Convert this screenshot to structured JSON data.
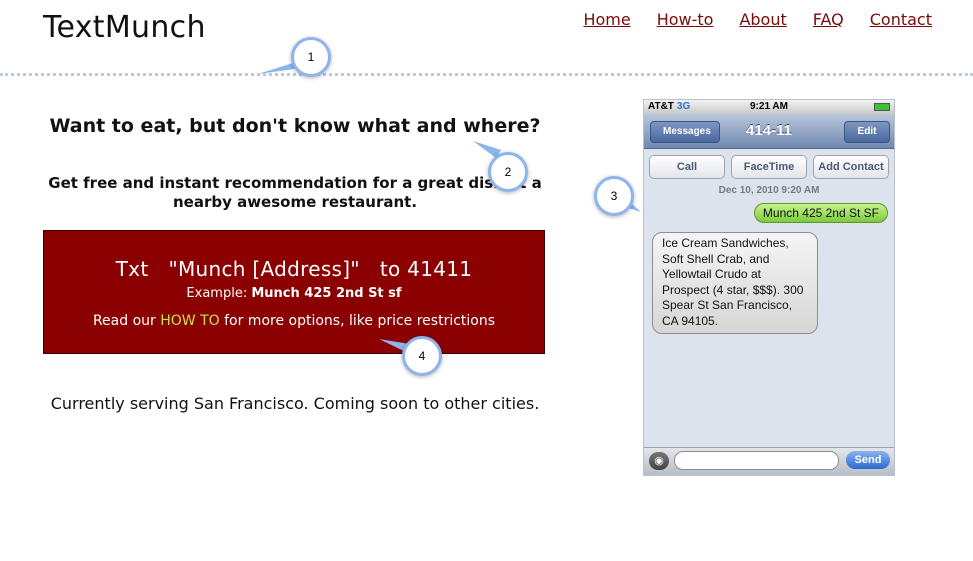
{
  "site": {
    "logo": "TextMunch"
  },
  "nav": {
    "items": [
      "Home",
      "How-to",
      "About",
      "FAQ",
      "Contact"
    ]
  },
  "hero": {
    "headline": "Want to eat, but don't know what and where?",
    "subline": "Get free and instant recommendation for a great dish at a nearby awesome restaurant."
  },
  "promo": {
    "txt_line": "Txt   \"Munch [Address]\"   to 41411",
    "example_label": "Example:",
    "example_value": "Munch 425 2nd St sf",
    "read_prefix": "Read our",
    "howto_link": "HOW TO",
    "read_suffix": "for more options, like price restrictions"
  },
  "serving": "Currently serving San Francisco. Coming soon to other cities.",
  "phone": {
    "carrier": "AT&T",
    "network": "3G",
    "time": "9:21 AM",
    "back_label": "Messages",
    "title": "414-11",
    "edit_label": "Edit",
    "actions": [
      "Call",
      "FaceTime",
      "Add Contact"
    ],
    "timestamp": "Dec 10, 2010 9:20 AM",
    "sent_message": "Munch 425 2nd St SF",
    "received_message": "Ice Cream Sandwiches, Soft Shell Crab, and Yellowtail Crudo at Prospect (4 star, $$$). 300 Spear St San Francisco, CA 94105.",
    "send_label": "Send"
  },
  "callouts": [
    "1",
    "2",
    "3",
    "4"
  ],
  "colors": {
    "accent_red": "#8b0000",
    "nav_link": "#7a0a0a",
    "howto_link": "#c9e24a",
    "callout_ring": "#8eb4ec"
  }
}
